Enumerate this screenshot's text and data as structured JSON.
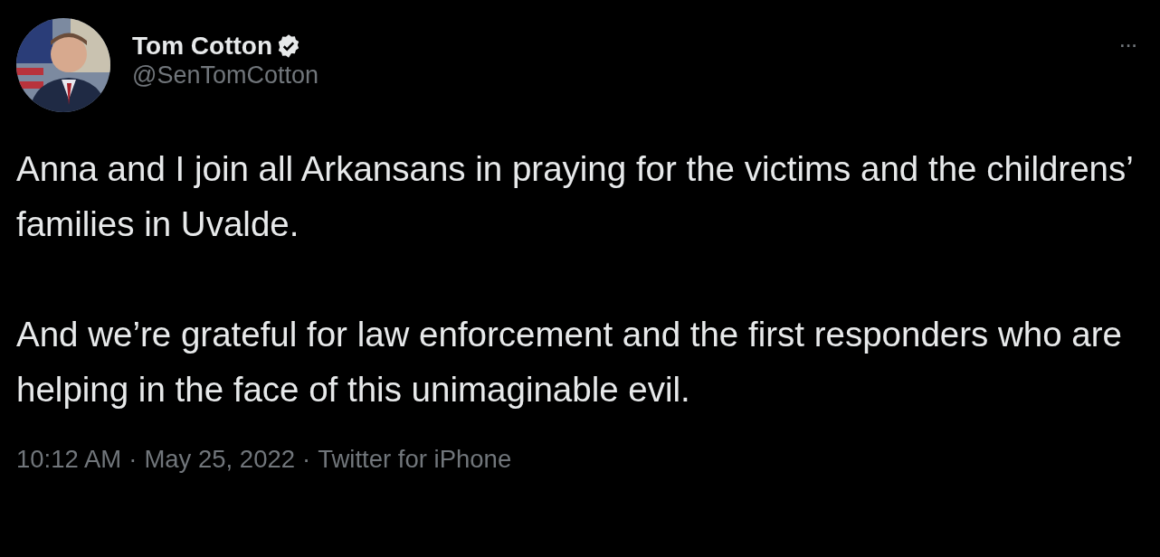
{
  "author": {
    "name": "Tom Cotton",
    "verified": true,
    "handle": "@SenTomCotton"
  },
  "more": "···",
  "paragraphs": [
    "Anna and I join all Arkansans in praying for the victims and the childrens’ families in Uvalde.",
    "And we’re grateful for law enforcement and the first responders who are helping in the face of this unimaginable evil."
  ],
  "meta": [
    "10:12 AM",
    "May 25, 2022",
    "Twitter for iPhone"
  ],
  "separator": "·"
}
